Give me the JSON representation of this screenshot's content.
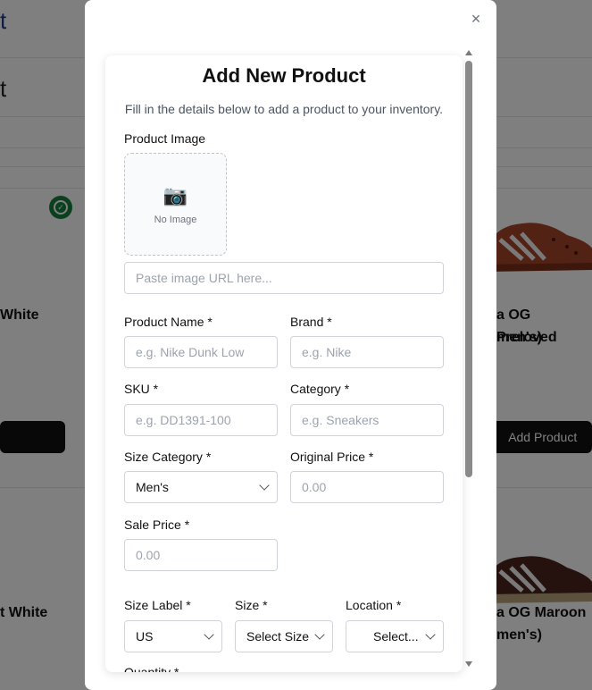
{
  "background": {
    "title_fragment": "t",
    "subtitle_fragment": "t",
    "cards": [
      {
        "name_fragment": "White"
      },
      {
        "name_fragment_line1": "a OG Preloved",
        "name_fragment_line2": "men's)"
      },
      {
        "name_fragment": "t White"
      },
      {
        "name_fragment_line1": "a OG Maroon",
        "name_fragment_line2": "men's)"
      }
    ],
    "add_product_label": "Add Product",
    "plus_glyph": "+"
  },
  "modal": {
    "close_glyph": "×",
    "title": "Add New Product",
    "subtitle": "Fill in the details below to add a product to your inventory.",
    "product_image": {
      "label": "Product Image",
      "camera_glyph": "📷",
      "no_image_text": "No Image",
      "url_placeholder": "Paste image URL here..."
    },
    "fields": {
      "product_name": {
        "label": "Product Name *",
        "placeholder": "e.g. Nike Dunk Low"
      },
      "brand": {
        "label": "Brand *",
        "placeholder": "e.g. Nike"
      },
      "sku": {
        "label": "SKU *",
        "placeholder": "e.g. DD1391-100"
      },
      "category": {
        "label": "Category *",
        "placeholder": "e.g. Sneakers"
      },
      "size_category": {
        "label": "Size Category *",
        "value": "Men's"
      },
      "original_price": {
        "label": "Original Price *",
        "placeholder": "0.00"
      },
      "sale_price": {
        "label": "Sale Price *",
        "placeholder": "0.00"
      },
      "size_label": {
        "label": "Size Label *",
        "value": "US"
      },
      "size": {
        "label": "Size *",
        "value": "Select Size"
      },
      "location": {
        "label": "Location *",
        "value": "Select..."
      },
      "quantity": {
        "label": "Quantity *"
      }
    }
  }
}
